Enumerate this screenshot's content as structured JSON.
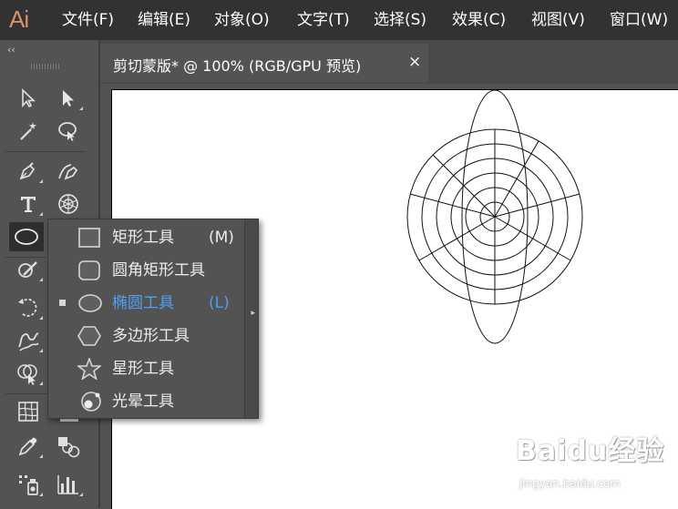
{
  "app": {
    "logo": "Ai"
  },
  "menu": {
    "items": [
      {
        "label": "文件(F)"
      },
      {
        "label": "编辑(E)"
      },
      {
        "label": "对象(O)"
      },
      {
        "label": "文字(T)"
      },
      {
        "label": "选择(S)"
      },
      {
        "label": "效果(C)"
      },
      {
        "label": "视图(V)"
      },
      {
        "label": "窗口(W)"
      }
    ]
  },
  "toolbar": {
    "collapse_glyph": "‹‹",
    "tools": [
      {
        "icon": "selection-tool-icon"
      },
      {
        "icon": "direct-selection-tool-icon"
      },
      {
        "icon": "magic-wand-tool-icon"
      },
      {
        "icon": "lasso-tool-icon"
      },
      {
        "icon": "pen-tool-icon"
      },
      {
        "icon": "curvature-tool-icon"
      },
      {
        "icon": "type-tool-icon",
        "glyph": "T"
      },
      {
        "icon": "polar-grid-tool-icon"
      },
      {
        "icon": "ellipse-tool-icon",
        "active": true
      },
      {
        "icon": "shaper-tool-icon"
      },
      {
        "icon": "rotate-tool-icon"
      },
      {
        "icon": "warp-tool-icon"
      },
      {
        "icon": "shape-builder-tool-icon"
      },
      {
        "icon": "mesh-tool-icon"
      },
      {
        "icon": "eyedropper-tool-icon"
      },
      {
        "icon": "blend-tool-icon"
      },
      {
        "icon": "symbol-sprayer-tool-icon"
      },
      {
        "icon": "column-graph-tool-icon"
      }
    ]
  },
  "document_tab": {
    "label": "剪切蒙版* @ 100% (RGB/GPU 预览)",
    "close": "×"
  },
  "flyout": {
    "items": [
      {
        "label": "矩形工具",
        "shortcut": "(M)",
        "icon": "rectangle-icon",
        "checked": false
      },
      {
        "label": "圆角矩形工具",
        "shortcut": "",
        "icon": "rounded-rectangle-icon",
        "checked": false
      },
      {
        "label": "椭圆工具",
        "shortcut": "(L)",
        "icon": "ellipse-icon",
        "checked": true
      },
      {
        "label": "多边形工具",
        "shortcut": "",
        "icon": "polygon-icon",
        "checked": false
      },
      {
        "label": "星形工具",
        "shortcut": "",
        "icon": "star-icon",
        "checked": false
      },
      {
        "label": "光晕工具",
        "shortcut": "",
        "icon": "flare-icon",
        "checked": false
      }
    ],
    "selected_color": "#4f9ff5",
    "expand_glyph": "▸"
  },
  "watermark": {
    "brand": "Baidu经验",
    "url": "jingyan.baidu.com"
  }
}
